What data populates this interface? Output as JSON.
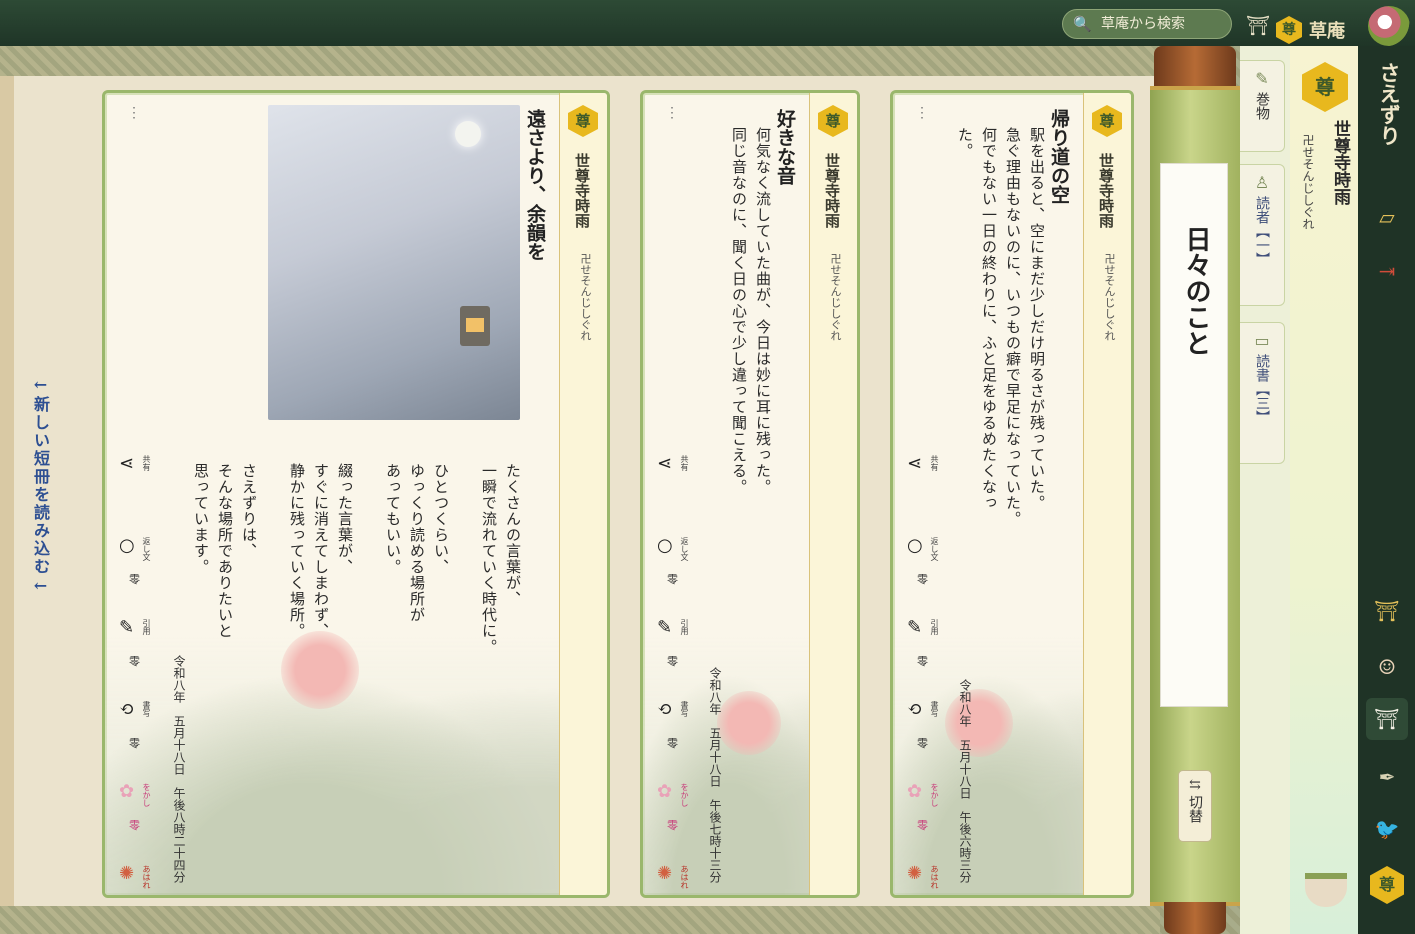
{
  "header": {
    "search_placeholder": "草庵から検索",
    "brand_name": "草庵",
    "brand_badge": "尊",
    "search_icon": "search-icon",
    "shrine_icon": "shrine-icon"
  },
  "sidebar_left": {
    "load_more": "←新しい短冊を読み込む←"
  },
  "cards": [
    {
      "badge": "尊",
      "author": "世尊寺時雨",
      "reading": "卍せそんじしぐれ",
      "title": "遠さより、余韻を",
      "body": [
        "たくさんの言葉が、",
        "一瞬で流れていく時代に。",
        "",
        "ひとつくらい、",
        "ゆっくり読める場所が",
        "あってもいい。",
        "",
        "綴った言葉が、",
        "すぐに消えてしまわず、",
        "静かに残っていく場所。",
        "",
        "さえずりは、",
        "そんな場所でありたいと",
        "思っています。"
      ],
      "date": "令和八年　五月十八日　午後八時二十四分",
      "has_image": true,
      "actions": [
        {
          "label": "共有",
          "count": ""
        },
        {
          "label": "返し文",
          "count": "零"
        },
        {
          "label": "引用",
          "count": "零"
        },
        {
          "label": "書写",
          "count": "零"
        },
        {
          "label": "をかし",
          "count": "零"
        },
        {
          "label": "あはれ",
          "count": "零"
        }
      ]
    },
    {
      "badge": "尊",
      "author": "世尊寺時雨",
      "reading": "卍せそんじしぐれ",
      "title": "好きな音",
      "body": [
        "何気なく流していた曲が、今日は妙に耳に残った。",
        "同じ音なのに、聞く日の心で少し違って聞こえる。"
      ],
      "date": "令和八年　五月十八日　午後七時十三分",
      "has_image": false,
      "actions": [
        {
          "label": "共有",
          "count": ""
        },
        {
          "label": "返し文",
          "count": "零"
        },
        {
          "label": "引用",
          "count": "零"
        },
        {
          "label": "書写",
          "count": "零"
        },
        {
          "label": "をかし",
          "count": "零"
        },
        {
          "label": "あはれ",
          "count": "零"
        }
      ]
    },
    {
      "badge": "尊",
      "author": "世尊寺時雨",
      "reading": "卍せそんじしぐれ",
      "title": "帰り道の空",
      "body": [
        "駅を出ると、空にまだ少しだけ明るさが残っていた。",
        "急ぐ理由もないのに、いつもの癖で早足になっていた。",
        "何でもない一日の終わりに、ふと足をゆるめたくなった。"
      ],
      "date": "令和八年　五月十八日　午後六時三分",
      "has_image": false,
      "actions": [
        {
          "label": "共有",
          "count": ""
        },
        {
          "label": "返し文",
          "count": "零"
        },
        {
          "label": "引用",
          "count": "零"
        },
        {
          "label": "書写",
          "count": "零"
        },
        {
          "label": "をかし",
          "count": "零"
        },
        {
          "label": "あはれ",
          "count": "零"
        }
      ]
    }
  ],
  "scroll": {
    "title": "日々のこと",
    "switch_label": "切替"
  },
  "tabs": [
    {
      "label": "巻物",
      "icon": "brush-icon"
    },
    {
      "label": "読者【一】",
      "icon": "person-icon"
    },
    {
      "label": "読書【三】",
      "icon": "book-icon"
    }
  ],
  "profile": {
    "badge": "尊",
    "name": "世尊寺時雨",
    "reading": "卍せそんじしぐれ"
  },
  "rail": {
    "app_name": "さえずり",
    "badge": "尊",
    "icons": [
      "writing-board-icon",
      "exit-icon",
      "shrine-gate-icon",
      "portrait-icon",
      "home-shrine-icon",
      "ink-brush-icon",
      "bird-icon"
    ]
  },
  "colors": {
    "accent_gold": "#e8b81e",
    "green_frame": "#9ab76c",
    "dark_rail": "#1f3326",
    "link_blue": "#2d4f92"
  }
}
